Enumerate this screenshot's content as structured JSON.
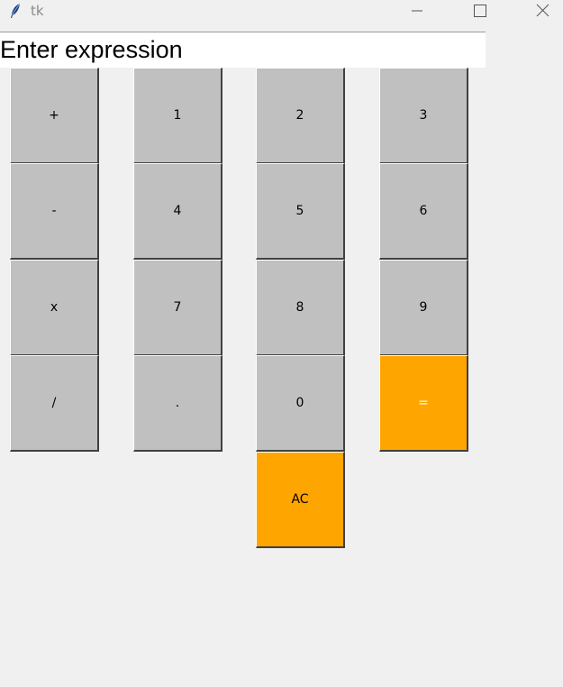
{
  "window": {
    "title": "tk",
    "icon": "feather-icon",
    "controls": [
      "minimize-icon",
      "maximize-icon",
      "close-icon"
    ]
  },
  "entry": {
    "value": "Enter expression"
  },
  "buttons": {
    "plus": "+",
    "one": "1",
    "two": "2",
    "three": "3",
    "minus": "-",
    "four": "4",
    "five": "5",
    "six": "6",
    "multiply": "x",
    "seven": "7",
    "eight": "8",
    "nine": "9",
    "divide": "/",
    "dot": ".",
    "zero": "0",
    "equals": "=",
    "clear": "AC"
  },
  "colors": {
    "button_gray": "#c0c0c0",
    "button_orange": "#ffa500",
    "background": "#f0f0f0"
  }
}
